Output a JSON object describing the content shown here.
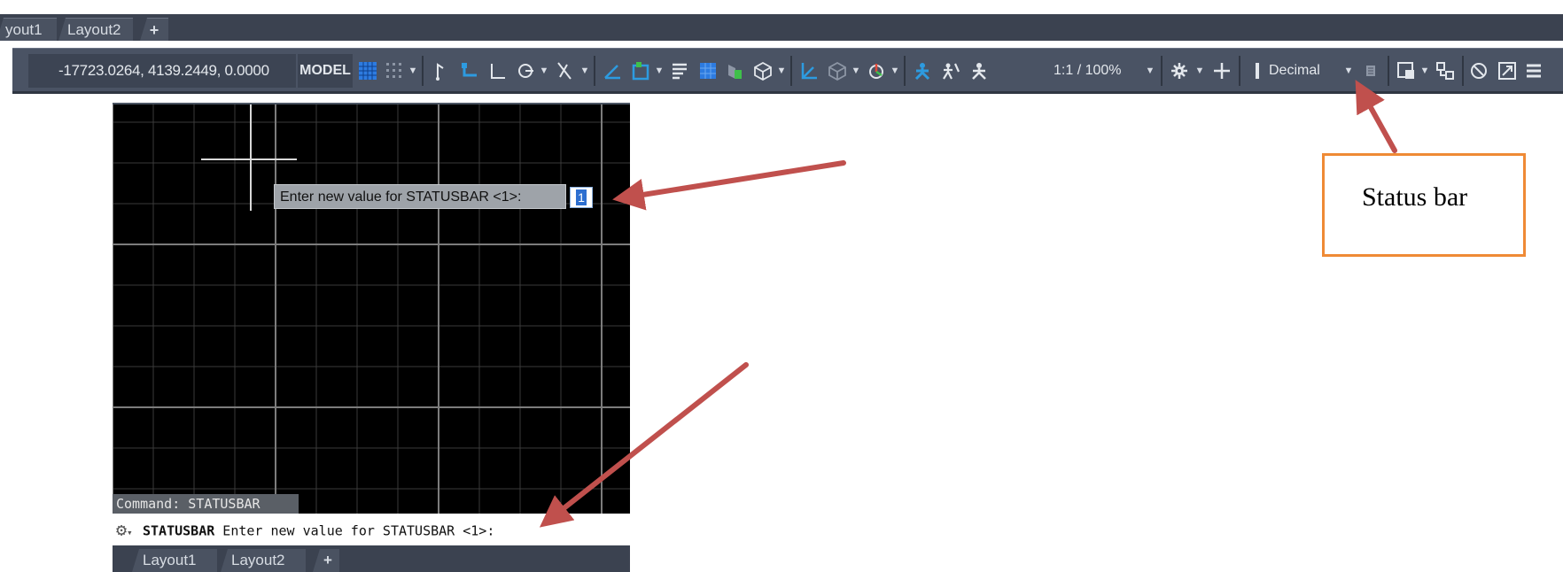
{
  "top_tabs": [
    "yout1",
    "Layout2",
    "+"
  ],
  "statusbar": {
    "coordinates": "-17723.0264, 4139.2449, 0.0000",
    "space": "MODEL",
    "annotation_scale": "1:1 / 100%",
    "units": "Decimal",
    "icons": [
      "grid-icon",
      "snap-icon",
      "ortho-icon",
      "infer-icon",
      "polar-icon",
      "isodraft-icon",
      "object-snap-tracking-icon",
      "object-snap-icon",
      "lineweight-icon",
      "transparency-icon",
      "selection-cycling-icon",
      "3d-object-snap-icon",
      "dynamic-ucs-icon",
      "selection-filter-icon",
      "gizmo-icon",
      "annotation-visibility-icon",
      "auto-scale-icon",
      "annotation-scale-icon",
      "workspace-icon",
      "annotation-monitor-icon",
      "units-icon",
      "quick-properties-icon",
      "lock-ui-icon",
      "isolate-objects-icon",
      "hardware-acceleration-icon",
      "clean-screen-icon",
      "customization-icon"
    ]
  },
  "drawing": {
    "prompt_text": "Enter new value for STATUSBAR <1>:",
    "prompt_value": "1",
    "history": "Command: STATUSBAR"
  },
  "command_line": {
    "command": "STATUSBAR",
    "prompt": " Enter new value for STATUSBAR <1>:"
  },
  "bottom_tabs": [
    "Layout1",
    "Layout2",
    "+"
  ],
  "callout": {
    "label": "Status bar"
  },
  "colors": {
    "statusbar_bg": "#4a5364",
    "active_blue": "#2d7be0",
    "arrow": "#c0504d",
    "callout_border": "#ef8a35"
  }
}
